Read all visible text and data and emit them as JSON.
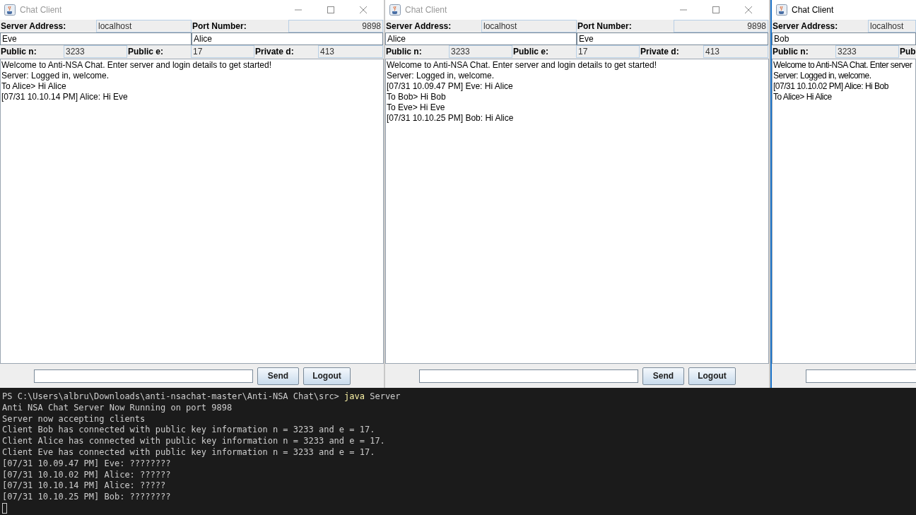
{
  "windows": [
    {
      "title": "Chat Client",
      "active": false,
      "title_buttons": true,
      "server_row": [
        {
          "kind": "label",
          "text": "Server Address:"
        },
        {
          "kind": "value",
          "text": "localhost"
        },
        {
          "kind": "label",
          "text": "Port Number:"
        },
        {
          "kind": "number",
          "text": "9898"
        }
      ],
      "login_row": [
        {
          "kind": "input",
          "text": "Eve"
        },
        {
          "kind": "input",
          "text": "Alice"
        }
      ],
      "key_row": [
        {
          "kind": "label",
          "text": "Public n:"
        },
        {
          "kind": "value",
          "text": "3233"
        },
        {
          "kind": "label",
          "text": "Public e:"
        },
        {
          "kind": "value",
          "text": "17"
        },
        {
          "kind": "label",
          "text": "Private d:"
        },
        {
          "kind": "value",
          "text": "413"
        }
      ],
      "messages": [
        "Welcome to Anti-NSA Chat. Enter server and login details to get started!",
        "Server: Logged in, welcome.",
        "To Alice> Hi Alice",
        "[07/31 10.10.14 PM] Alice: Hi Eve"
      ],
      "buttons": [
        "Send",
        "Logout"
      ]
    },
    {
      "title": "Chat Client",
      "active": false,
      "title_buttons": true,
      "server_row": [
        {
          "kind": "label",
          "text": "Server Address:"
        },
        {
          "kind": "value",
          "text": "localhost"
        },
        {
          "kind": "label",
          "text": "Port Number:"
        },
        {
          "kind": "number",
          "text": "9898"
        }
      ],
      "login_row": [
        {
          "kind": "input",
          "text": "Alice"
        },
        {
          "kind": "input",
          "text": "Eve"
        }
      ],
      "key_row": [
        {
          "kind": "label",
          "text": "Public n:"
        },
        {
          "kind": "value",
          "text": "3233"
        },
        {
          "kind": "label",
          "text": "Public e:"
        },
        {
          "kind": "value",
          "text": "17"
        },
        {
          "kind": "label",
          "text": "Private d:"
        },
        {
          "kind": "value",
          "text": "413"
        }
      ],
      "messages": [
        "Welcome to Anti-NSA Chat. Enter server and login details to get started!",
        "Server: Logged in, welcome.",
        "[07/31 10.09.47 PM] Eve: Hi Alice",
        "To Bob> Hi Bob",
        "To Eve> Hi Eve",
        "[07/31 10.10.25 PM] Bob: Hi Alice"
      ],
      "buttons": [
        "Send",
        "Logout"
      ]
    },
    {
      "title": "Chat Client",
      "active": true,
      "title_buttons": false,
      "server_row": [
        {
          "kind": "label",
          "text": "Server Address:"
        },
        {
          "kind": "value",
          "text": "localhost"
        }
      ],
      "login_row": [
        {
          "kind": "input",
          "text": "Bob"
        }
      ],
      "key_row": [
        {
          "kind": "label",
          "text": "Public n:"
        },
        {
          "kind": "value",
          "text": "3233"
        },
        {
          "kind": "label",
          "text": "Pub"
        }
      ],
      "messages": [
        "Welcome to Anti-NSA Chat. Enter server",
        "Server: Logged in, welcome.",
        "[07/31 10.10.02 PM] Alice: Hi Bob",
        "To Alice> Hi Alice"
      ]
    }
  ],
  "terminal": {
    "prompt": "PS C:\\Users\\albru\\Downloads\\anti-nsachat-master\\Anti-NSA Chat\\src> ",
    "command": "java",
    "args": "Server",
    "lines": [
      "Anti NSA Chat Server Now Running on port 9898",
      "Server now accepting clients",
      "Client Bob has connected with public key information n = 3233 and e = 17.",
      "Client Alice has connected with public key information n = 3233 and e = 17.",
      "Client Eve has connected with public key information n = 3233 and e = 17.",
      "[07/31 10.09.47 PM] Eve: ????????",
      "[07/31 10.10.02 PM] Alice: ??????",
      "[07/31 10.10.14 PM] Alice: ?????",
      "[07/31 10.10.25 PM] Bob: ????????"
    ]
  }
}
